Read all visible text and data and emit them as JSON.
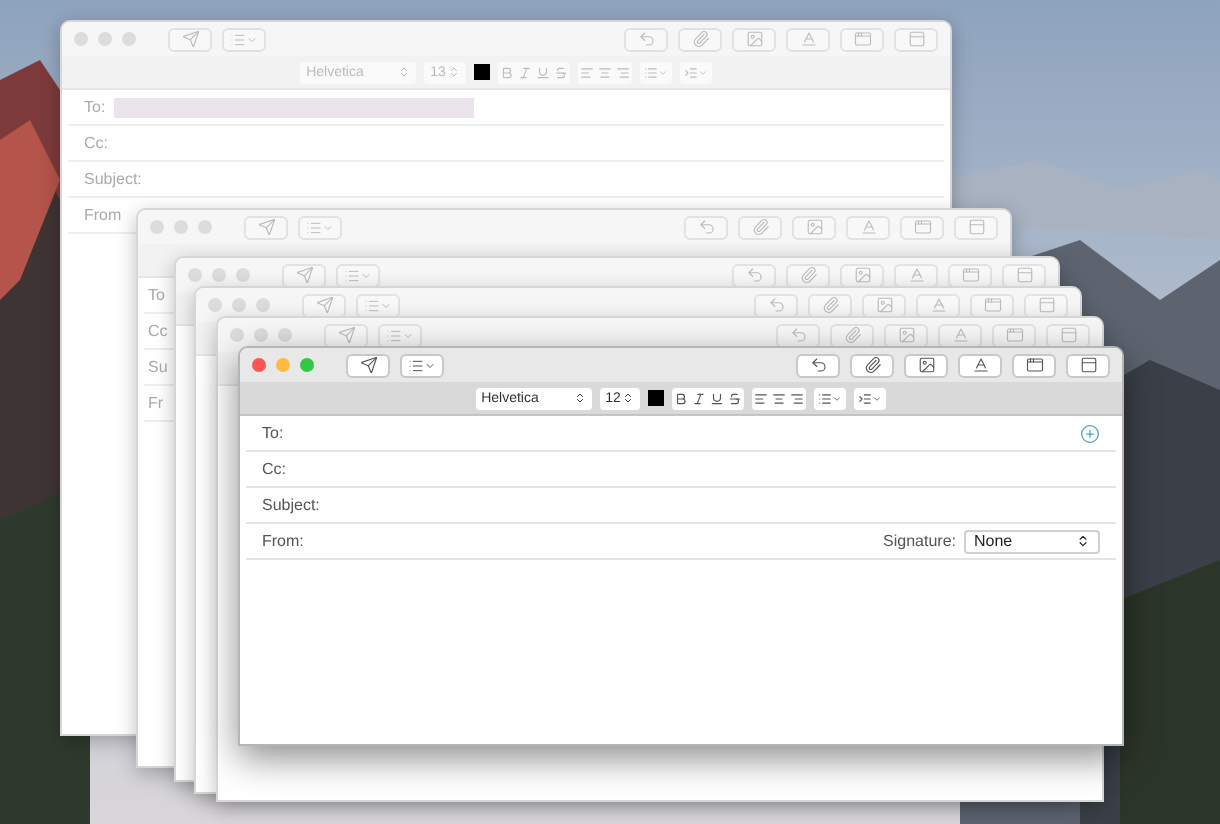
{
  "windows": [
    {
      "active": false,
      "format_bar": {
        "font": "Helvetica",
        "size": "13"
      },
      "fields": [
        {
          "label": "To:",
          "redacted": true
        },
        {
          "label": "Cc:"
        },
        {
          "label": "Subject:"
        },
        {
          "label": "From"
        }
      ]
    },
    {
      "active": false,
      "fields": [
        {
          "label": "To"
        },
        {
          "label": "Cc"
        },
        {
          "label": "Su"
        },
        {
          "label": "Fr"
        }
      ]
    },
    {
      "active": false
    },
    {
      "active": false
    },
    {
      "active": false
    },
    {
      "active": true,
      "format_bar": {
        "font": "Helvetica",
        "size": "12"
      },
      "fields": [
        {
          "label": "To:",
          "add_button": true
        },
        {
          "label": "Cc:"
        },
        {
          "label": "Subject:"
        },
        {
          "label": "From:",
          "signature": {
            "label": "Signature:",
            "value": "None"
          }
        }
      ]
    }
  ]
}
